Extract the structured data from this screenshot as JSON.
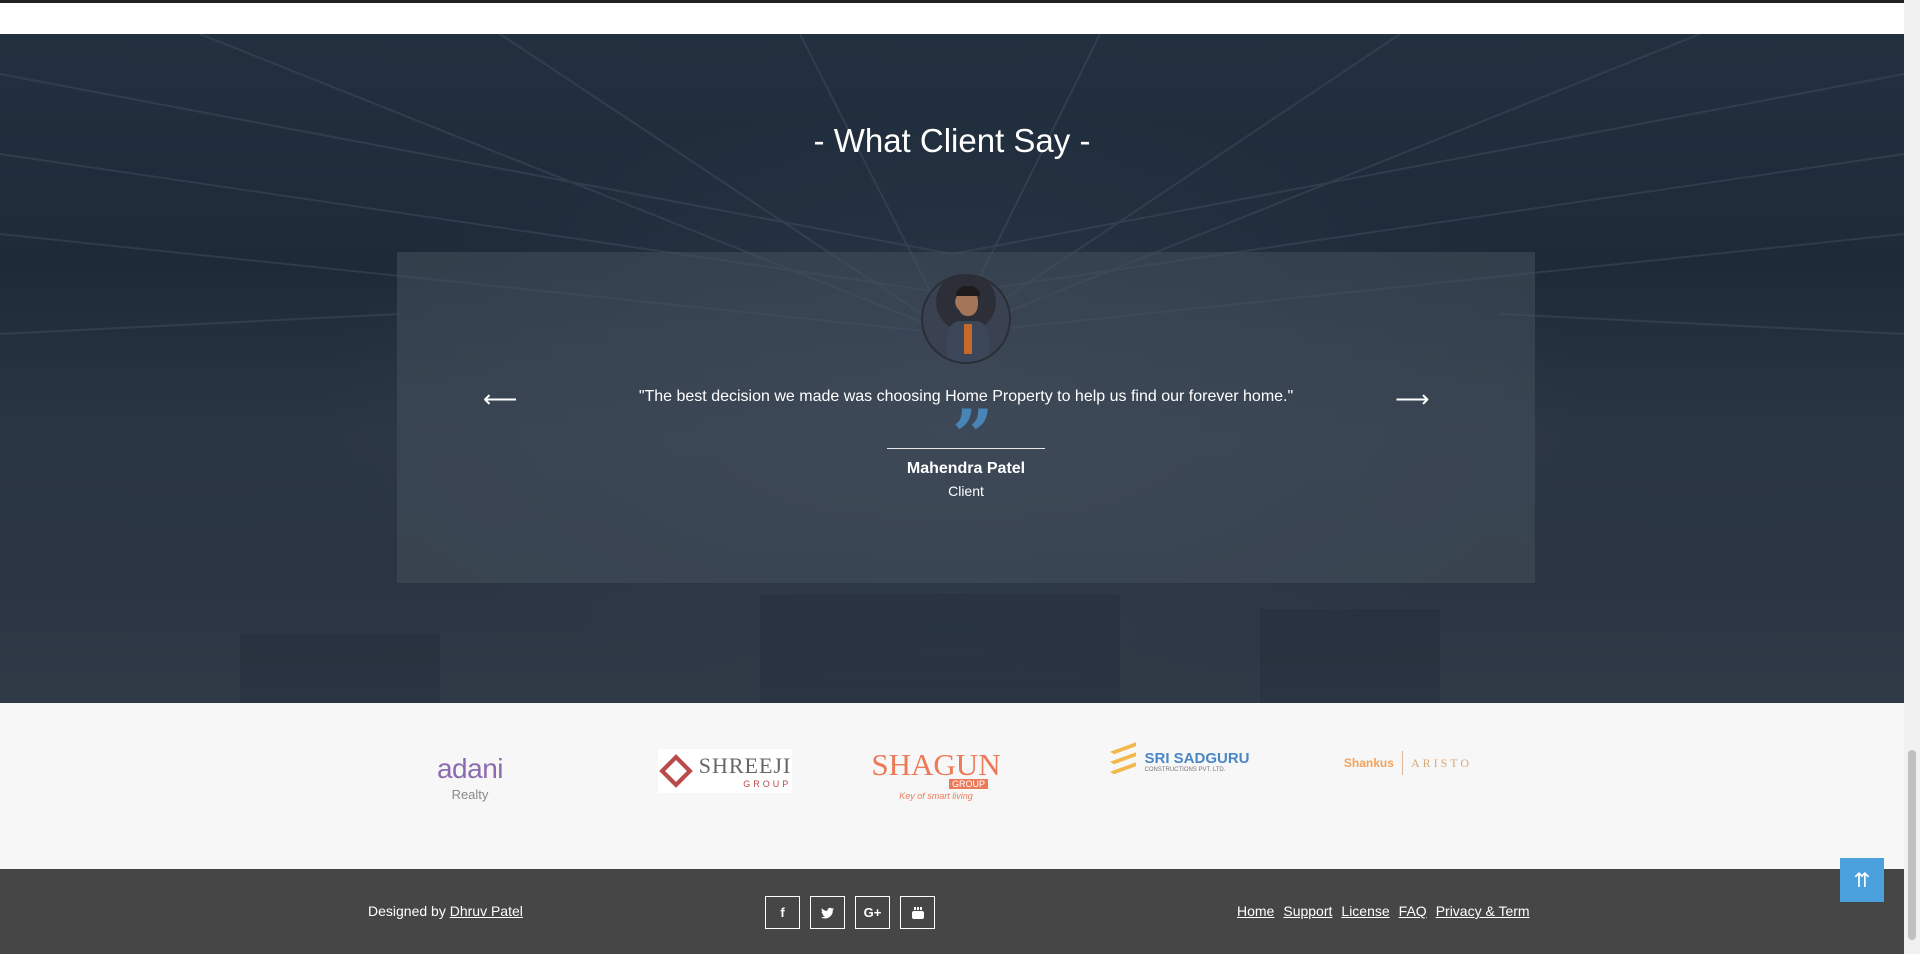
{
  "testimonials": {
    "title": "- What Client Say -",
    "quote": "\"The best decision we made was choosing Home Property to help us find our forever home.\"",
    "client_name": "Mahendra Patel",
    "client_role": "Client",
    "prev_icon": "arrow-left-icon",
    "next_icon": "arrow-right-icon"
  },
  "partners": {
    "adani": {
      "name": "adani",
      "sub": "Realty"
    },
    "shreeji": {
      "name": "SHREEJI",
      "sub": "GROUP"
    },
    "shagun": {
      "name": "SHAGUN",
      "sub": "GROUP",
      "tagline": "Key of smart living"
    },
    "sadguru": {
      "name": "SRI SADGURU",
      "sub": "CONSTRUCTIONS PVT. LTD."
    },
    "shankus": {
      "name": "Shankus",
      "sub": "ARISTO"
    }
  },
  "footer": {
    "credit_prefix": "Designed by ",
    "credit_link": "Dhruv Patel",
    "social": [
      "f",
      "t",
      "G+",
      "yt"
    ],
    "links": [
      "Home",
      "Support",
      "License",
      "FAQ",
      "Privacy & Term"
    ]
  },
  "colors": {
    "accent": "#4aa1dd",
    "footer_bg": "#464646",
    "quote_mark": "#4a8fc7"
  }
}
